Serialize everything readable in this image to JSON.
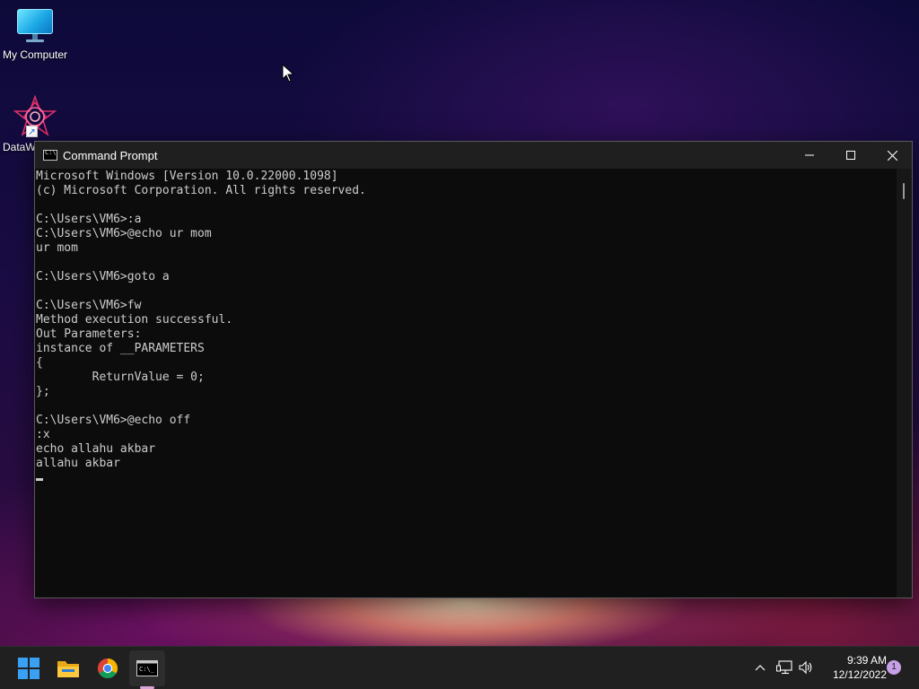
{
  "desktop": {
    "icons": [
      {
        "label": "My Computer",
        "icon": "monitor-icon"
      },
      {
        "label": "DataW",
        "icon": "star-shortcut-icon"
      }
    ]
  },
  "window": {
    "title": "Command Prompt",
    "console_lines": [
      "Microsoft Windows [Version 10.0.22000.1098]",
      "(c) Microsoft Corporation. All rights reserved.",
      "",
      "C:\\Users\\VM6>:a",
      "C:\\Users\\VM6>@echo ur mom",
      "ur mom",
      "",
      "C:\\Users\\VM6>goto a",
      "",
      "C:\\Users\\VM6>fw",
      "Method execution successful.",
      "Out Parameters:",
      "instance of __PARAMETERS",
      "{",
      "        ReturnValue = 0;",
      "};",
      "",
      "C:\\Users\\VM6>@echo off",
      ":x",
      "echo allahu akbar",
      "allahu akbar",
      ""
    ],
    "colors": {
      "console_bg": "#0c0c0c",
      "console_fg": "#cccccc",
      "titlebar_bg": "#1f1f1f"
    }
  },
  "taskbar": {
    "apps": [
      {
        "name": "Start",
        "icon": "windows-logo-icon"
      },
      {
        "name": "File Explorer",
        "icon": "folder-icon"
      },
      {
        "name": "Google Chrome",
        "icon": "chrome-icon"
      },
      {
        "name": "Command Prompt",
        "icon": "cmd-icon",
        "active": true
      }
    ],
    "tray": {
      "icons": [
        "chevron-up-icon",
        "network-icon",
        "volume-icon"
      ]
    },
    "clock": {
      "time": "9:39 AM",
      "date": "12/12/2022"
    },
    "notifications": "1"
  }
}
